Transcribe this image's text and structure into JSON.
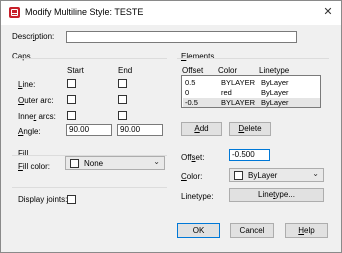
{
  "window": {
    "title": "Modify Multiline Style: TESTE",
    "close_glyph": "✕"
  },
  "description": {
    "label_pre": "Descr",
    "label_u": "i",
    "label_post": "ption:",
    "value": ""
  },
  "caps": {
    "title": "Caps",
    "col_start": "Start",
    "col_end": "End",
    "line_u": "L",
    "line_post": "ine:",
    "outer_u": "O",
    "outer_post": "uter arc:",
    "inner_pre": "Inne",
    "inner_u": "r",
    "inner_post": " arcs:",
    "angle_u": "A",
    "angle_post": "ngle:",
    "angle_start": "90.00",
    "angle_end": "90.00"
  },
  "fill": {
    "title": "Fill",
    "label_u": "F",
    "label_post": "ill color:",
    "value": "None"
  },
  "display_joints": {
    "label_pre": "Display ",
    "label_u": "j",
    "label_post": "oints:"
  },
  "elements": {
    "title_u": "E",
    "title_post": "lements",
    "headers": [
      "Offset",
      "Color",
      "Linetype"
    ],
    "rows": [
      {
        "offset": "0.5",
        "color": "BYLAYER",
        "linetype": "ByLayer"
      },
      {
        "offset": "0",
        "color": "red",
        "linetype": "ByLayer"
      },
      {
        "offset": "-0.5",
        "color": "BYLAYER",
        "linetype": "ByLayer"
      }
    ],
    "add_u": "A",
    "add_post": "dd",
    "delete_u": "D",
    "delete_post": "elete",
    "offset_label_pre": "Off",
    "offset_label_u": "s",
    "offset_label_post": "et:",
    "offset_value": "-0.500",
    "color_label_u": "C",
    "color_label_post": "olor:",
    "color_value": "ByLayer",
    "linetype_label": "Linetype:",
    "linetype_btn_pre": "Line",
    "linetype_btn_u": "t",
    "linetype_btn_post": "ype..."
  },
  "footer": {
    "ok": "OK",
    "cancel": "Cancel",
    "help_u": "H",
    "help_post": "elp"
  }
}
